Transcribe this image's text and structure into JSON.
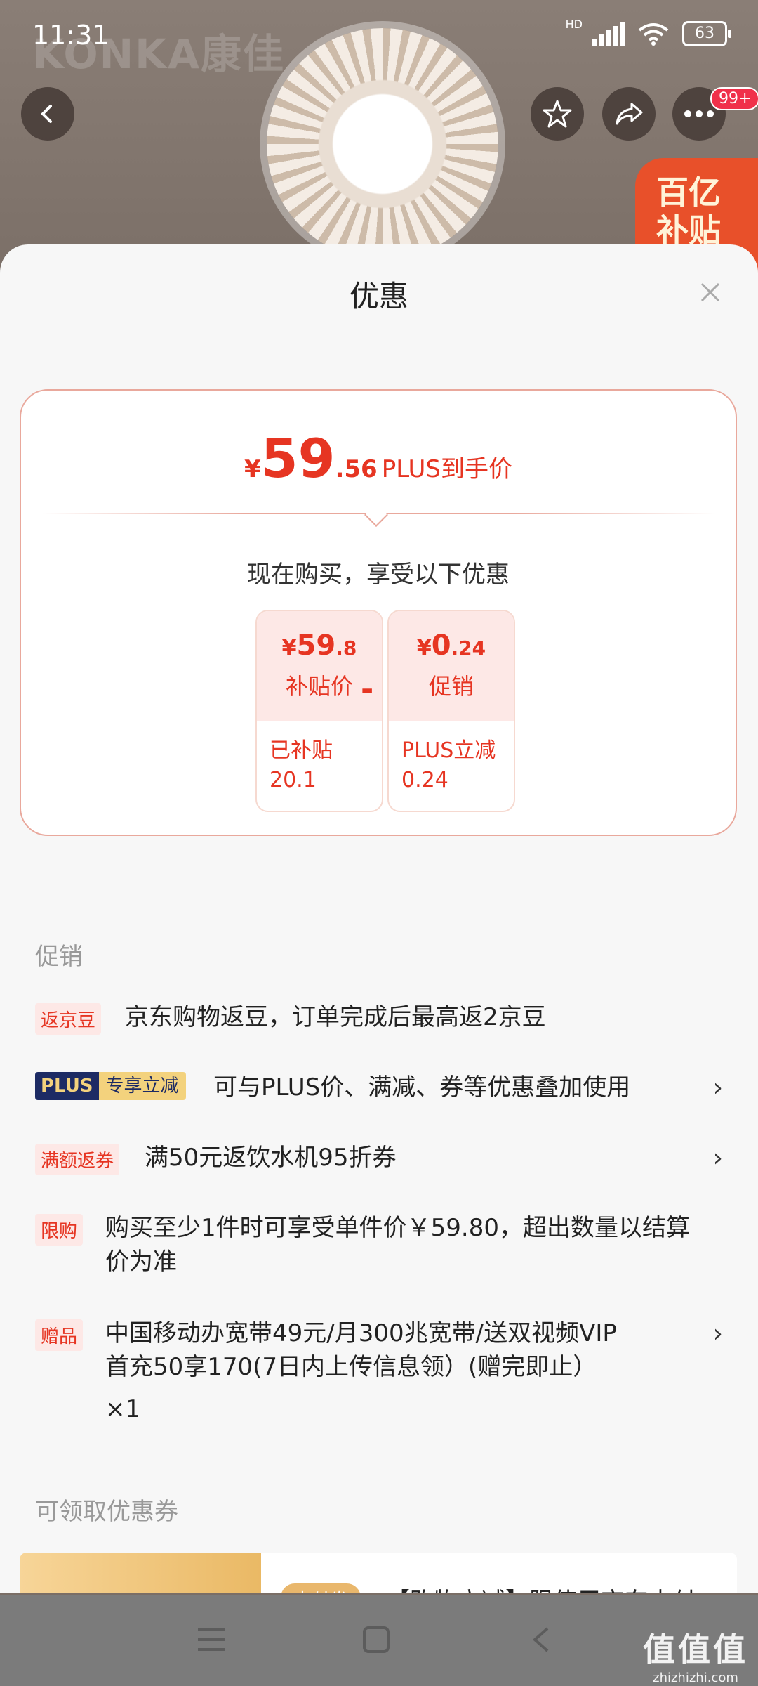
{
  "status_bar": {
    "time": "11:31",
    "network": "HD",
    "battery": "63"
  },
  "background": {
    "brand_text": "KONKA康佳",
    "promo_badge_line1": "百亿",
    "promo_badge_line2": "补贴"
  },
  "top_nav": {
    "badge_count": "99+"
  },
  "sheet": {
    "title": "优惠",
    "price_card": {
      "currency": "¥",
      "price_int": "59",
      "price_dec": ".56",
      "price_label": "PLUS到手价",
      "buy_now_text": "现在购买，享受以下优惠",
      "breakdown": [
        {
          "currency": "¥",
          "int": "59",
          "dec": ".8",
          "label": "补贴价",
          "detail_line1": "已补贴",
          "detail_line2": "20.1"
        },
        {
          "currency": "¥",
          "int": "0",
          "dec": ".24",
          "label": "促销",
          "detail_line1": "PLUS立减",
          "detail_line2": "0.24"
        }
      ],
      "operator": "-"
    },
    "promotions_title": "促销",
    "promotions": [
      {
        "tag": "返京豆",
        "text": "京东购物返豆，订单完成后最高返2京豆",
        "has_arrow": false
      },
      {
        "tag_a": "PLUS",
        "tag_b": "专享立减",
        "text": "可与PLUS价、满减、券等优惠叠加使用",
        "has_arrow": true
      },
      {
        "tag": "满额返券",
        "text": "满50元返饮水机95折券",
        "has_arrow": true
      },
      {
        "tag": "限购",
        "text_line1": "购买至少1件时可享受单件价￥59.80，超出数量以结算",
        "text_line2": "价为准",
        "has_arrow": false
      },
      {
        "tag": "赠品",
        "text_line1": "中国移动办宽带49元/月300兆宽带/送双视频VIP",
        "text_line2": "首充50享170(7日内上传信息领）(赠完即止）",
        "text_line3": "×1",
        "has_arrow": true
      }
    ],
    "coupons_title": "可领取优惠券",
    "coupon": {
      "tag": "支付券",
      "text": "【购物立减】限使用京东支付"
    }
  },
  "watermark": {
    "line1": "值值值",
    "line2": "zhizhizhi.com"
  },
  "colors": {
    "accent": "#e63522",
    "sheet_bg": "#f7f7f7",
    "plus_navy": "#1d2b64",
    "plus_gold": "#f3d27d"
  }
}
